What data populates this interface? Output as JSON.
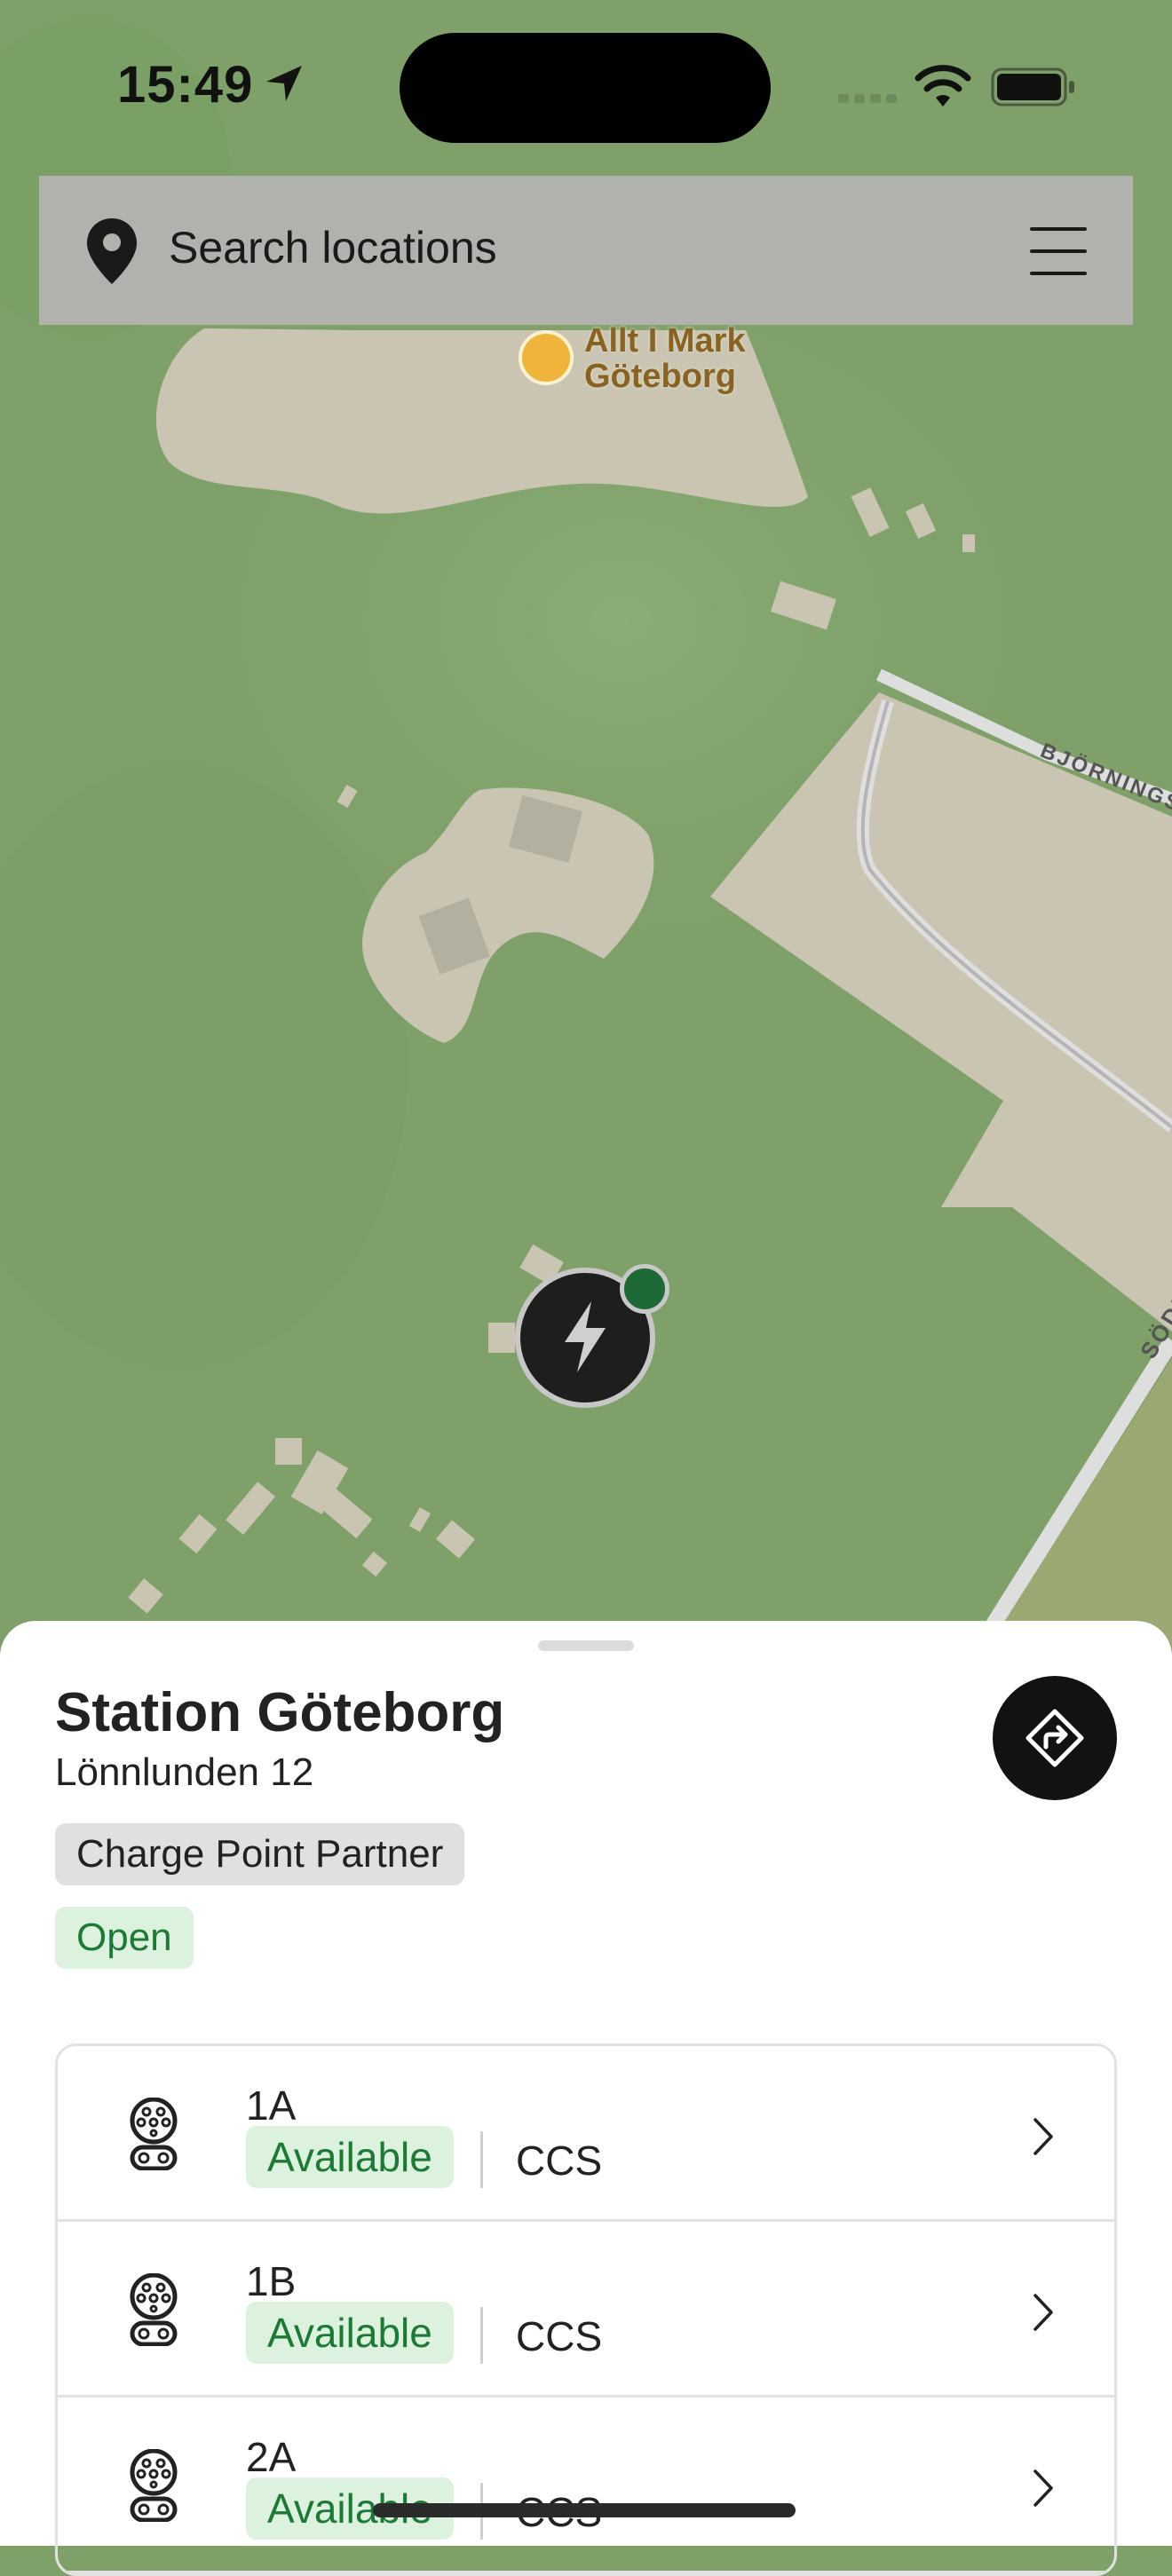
{
  "status_bar": {
    "time": "15:49"
  },
  "search": {
    "placeholder": "Search locations"
  },
  "map": {
    "poi_label_line1": "Allt I Mark",
    "poi_label_line2": "Göteborg",
    "street_1": "BJÖRNINGS",
    "street_2": "SÖDI"
  },
  "station": {
    "name": "Station Göteborg",
    "address": "Lönnlunden 12",
    "partner_tag": "Charge Point Partner",
    "open_status": "Open",
    "connectors": [
      {
        "name": "1A",
        "status": "Available",
        "type": "CCS"
      },
      {
        "name": "1B",
        "status": "Available",
        "type": "CCS"
      },
      {
        "name": "2A",
        "status": "Available",
        "type": "CCS"
      }
    ]
  },
  "colors": {
    "map_green": "#7fa169",
    "available_green": "#1b7a33",
    "available_bg": "#dcf2df",
    "marker_dot": "#1e6a36"
  }
}
